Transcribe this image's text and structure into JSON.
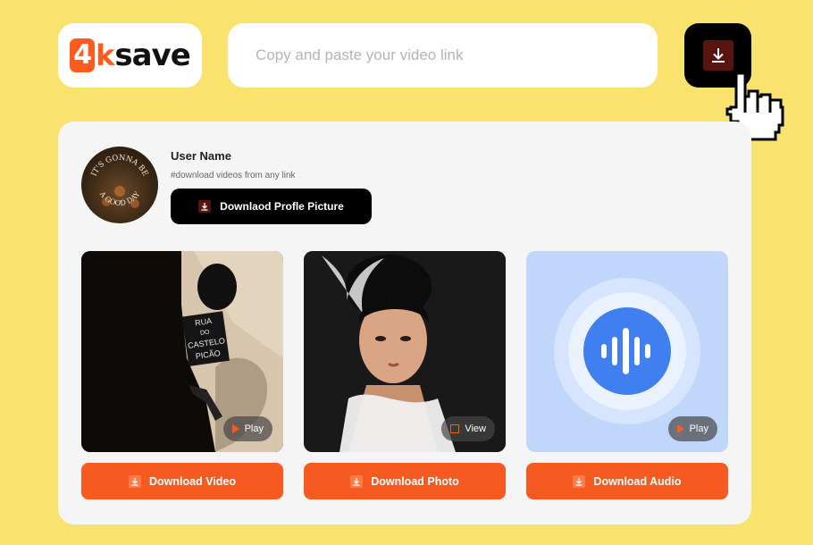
{
  "logo": {
    "four": "4",
    "k": "k",
    "save": "save"
  },
  "search": {
    "placeholder": "Copy and paste your video link",
    "value": ""
  },
  "profile": {
    "username": "User Name",
    "tagline": "#download videos from any link",
    "download_button_label": "Downlaod Profle Picture",
    "avatar_text_top": "IT'S GONNA BE",
    "avatar_text_bottom": "A GOOD DAY"
  },
  "media": [
    {
      "type": "video",
      "badge_label": "Play",
      "badge_icon": "play-icon",
      "sign_lines": [
        "RUA",
        "DO",
        "CASTELO",
        "PICÃO"
      ],
      "button_label": "Download Video"
    },
    {
      "type": "photo",
      "badge_label": "View",
      "badge_icon": "expand-icon",
      "button_label": "Download Photo"
    },
    {
      "type": "audio",
      "badge_label": "Play",
      "badge_icon": "play-icon",
      "button_label": "Download Audio"
    }
  ],
  "colors": {
    "background": "#f9e36e",
    "accent": "#f65a20",
    "dark": "#000000",
    "audio_tile": "#c1d6fb",
    "audio_blue": "#3f7ff0"
  },
  "icons": {
    "main_download": "download-icon",
    "cursor": "hand-pointer-icon"
  }
}
